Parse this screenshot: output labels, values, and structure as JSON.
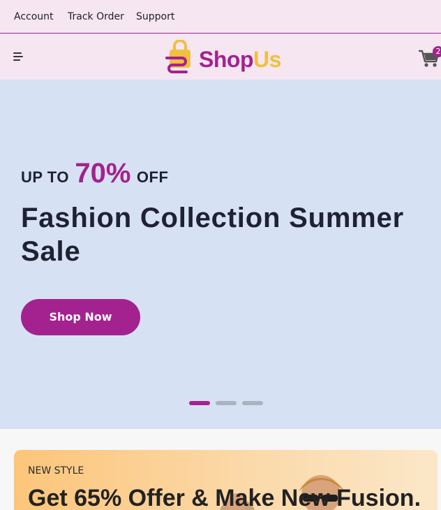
{
  "topbar": {
    "links": [
      "Account",
      "Track Order",
      "Support"
    ]
  },
  "header": {
    "menu_icon": "hamburger-icon",
    "logo": {
      "part1": "Shop",
      "part2": "Us",
      "icon": "shopping-bag-icon"
    },
    "cart": {
      "icon": "cart-icon",
      "count": "2"
    }
  },
  "hero": {
    "promo_prefix": "UP TO",
    "promo_value": "70%",
    "promo_suffix": "OFF",
    "title": "Fashion Collection Summer Sale",
    "button_label": "Shop Now",
    "slides": {
      "count": 3,
      "active": 1
    }
  },
  "promo_card": {
    "tag": "NEW STYLE",
    "title": "Get 65% Offer & Make New Fusion."
  },
  "colors": {
    "brand_purple": "#a3228f",
    "brand_yellow": "#f0c040",
    "topbar_bg": "#f5e6f1",
    "hero_bg": "#d6e2f3",
    "dot_inactive": "#a9b3c0",
    "text_dark": "#1f2233"
  }
}
